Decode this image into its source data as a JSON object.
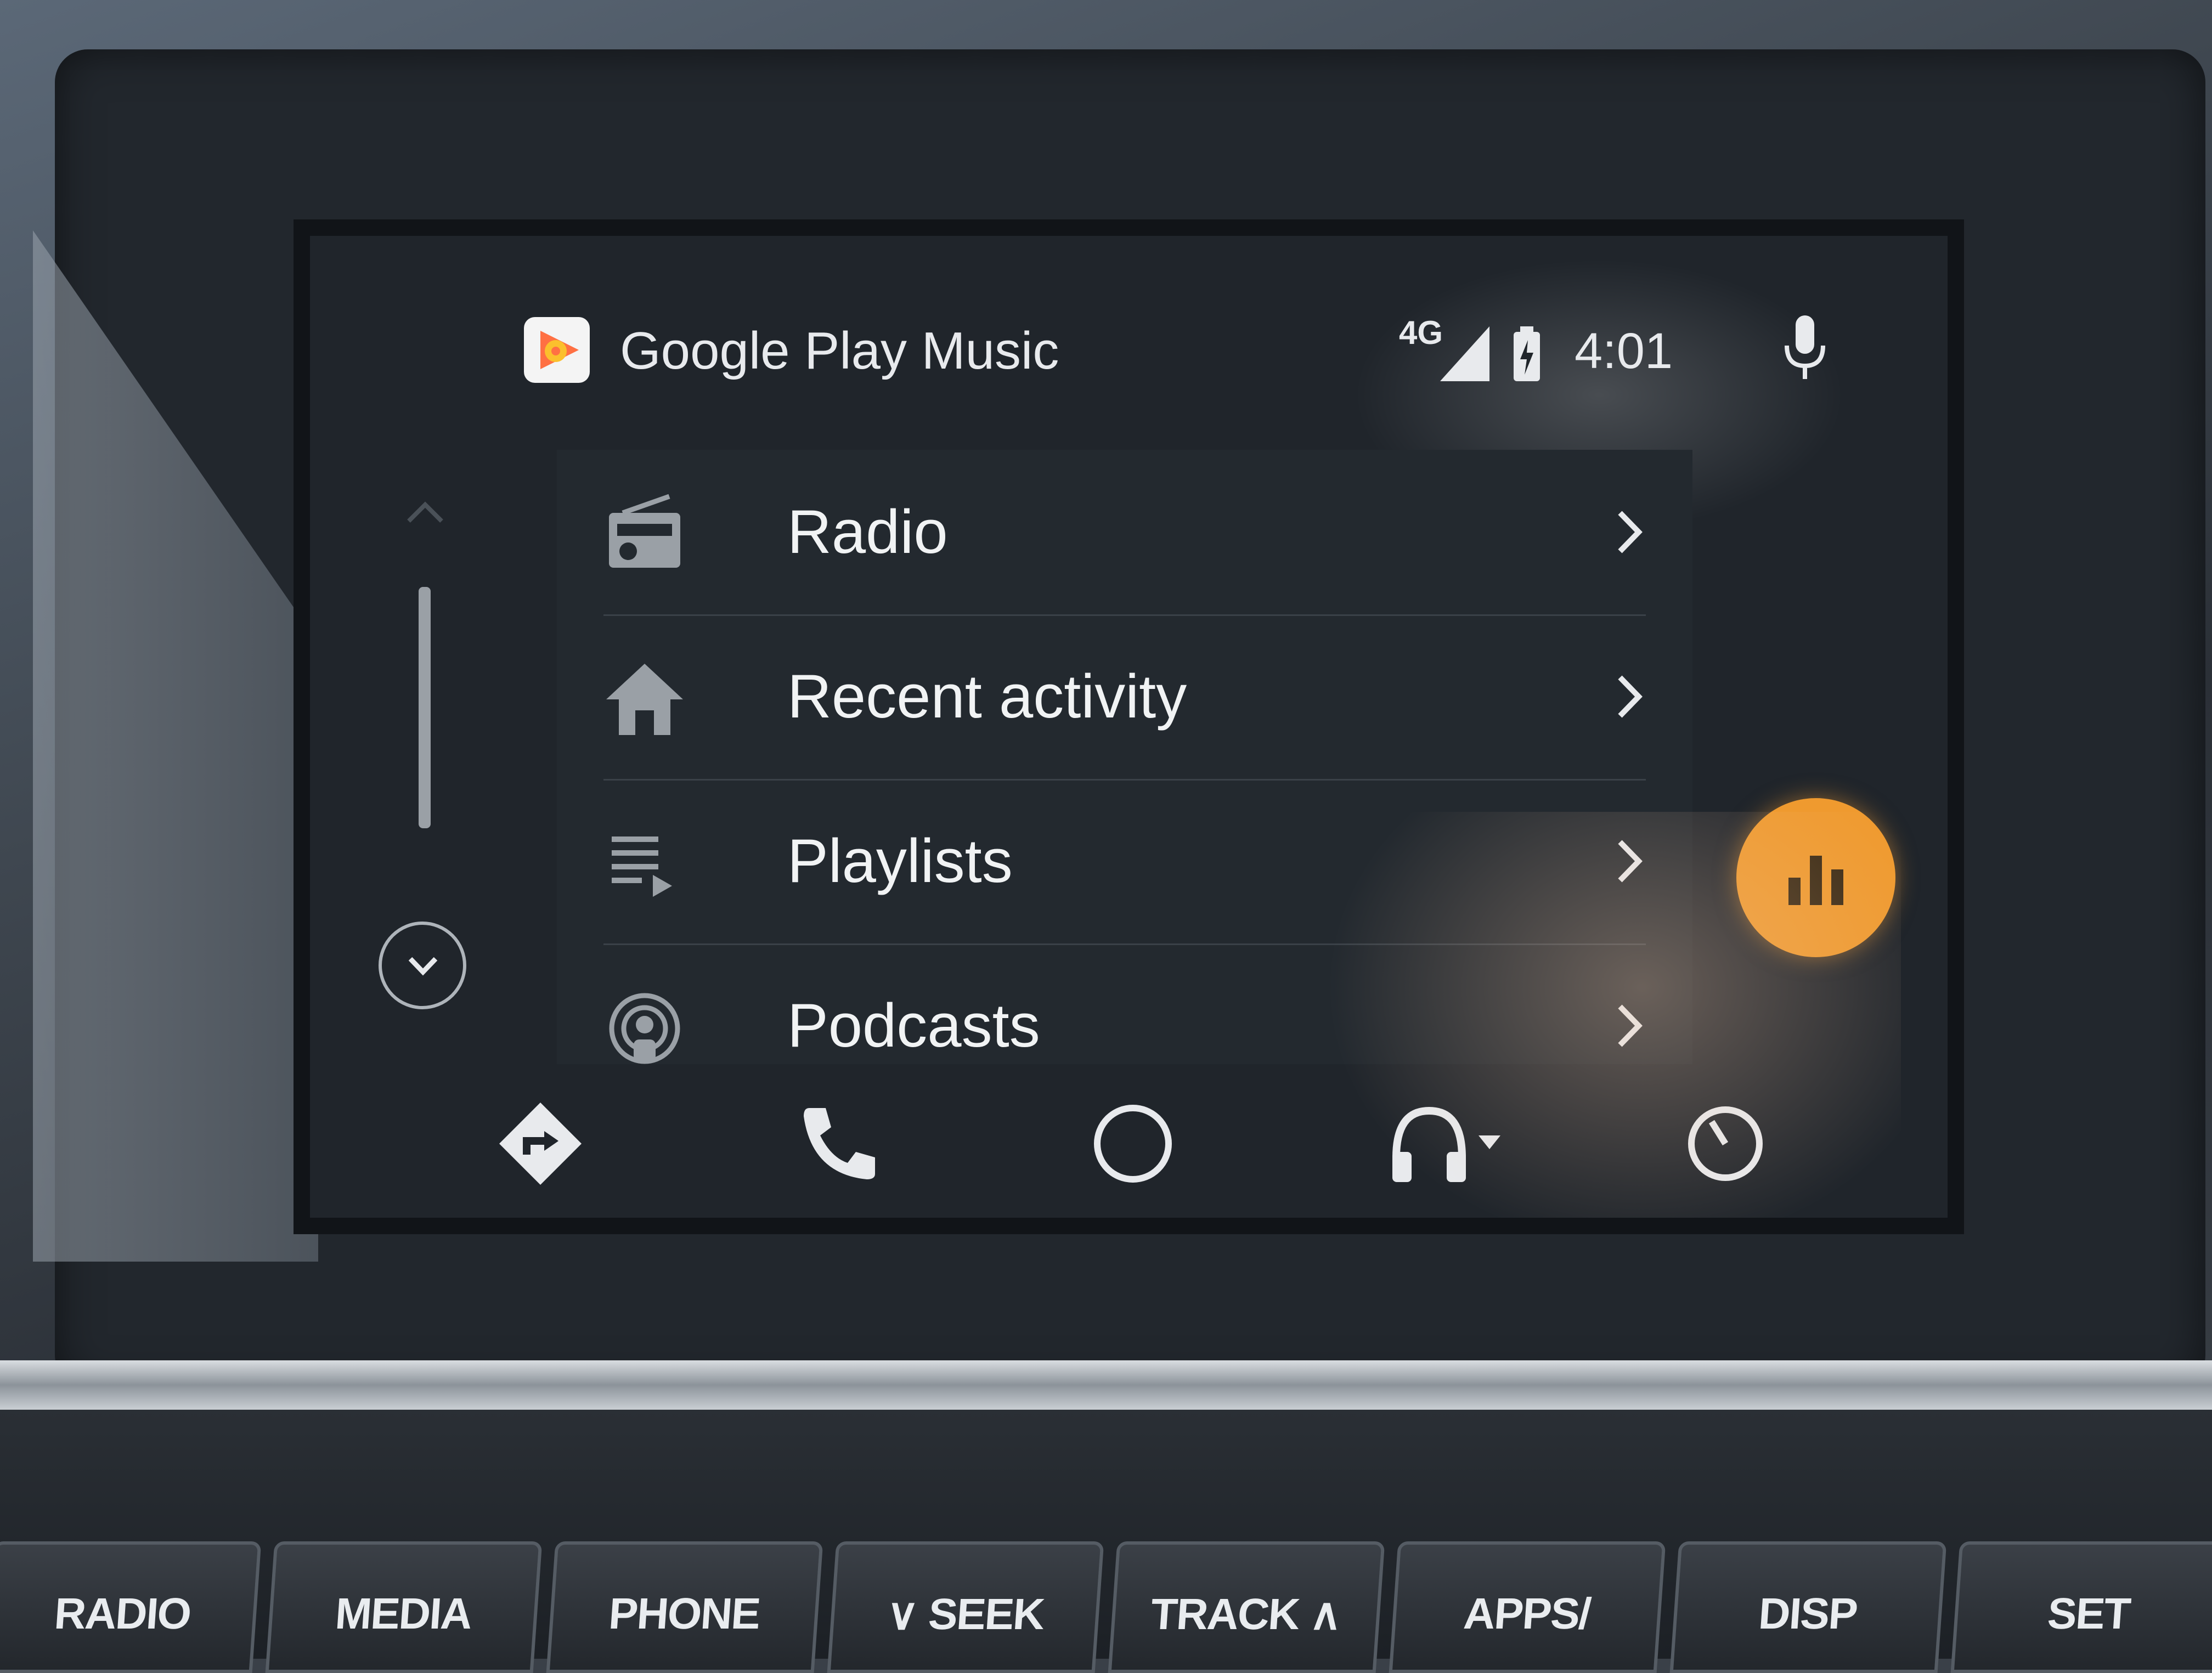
{
  "screen": {
    "app": {
      "title": "Google Play Music",
      "logo_icon": "google-play-music-logo",
      "accent": "#ef9a2f"
    },
    "status": {
      "network": "4G",
      "signal_icon": "cell-signal-icon",
      "battery_icon": "battery-charging-icon",
      "time": "4:01",
      "mic_icon": "microphone-icon"
    },
    "list": {
      "items": [
        {
          "label": "Radio",
          "icon": "radio-icon"
        },
        {
          "label": "Recent activity",
          "icon": "home-icon"
        },
        {
          "label": "Playlists",
          "icon": "playlist-icon"
        },
        {
          "label": "Podcasts",
          "icon": "podcast-icon"
        }
      ]
    },
    "fab": {
      "icon": "equalizer-icon"
    },
    "nav": {
      "items": [
        {
          "icon": "navigation-icon"
        },
        {
          "icon": "phone-icon"
        },
        {
          "icon": "home-circle-icon"
        },
        {
          "icon": "headphones-icon"
        },
        {
          "icon": "dashboard-icon"
        }
      ]
    }
  },
  "car": {
    "buttons": [
      "RADIO",
      "MEDIA",
      "PHONE",
      "∨ SEEK",
      "TRACK ∧",
      "APPS/",
      "DISP",
      "SET"
    ]
  }
}
